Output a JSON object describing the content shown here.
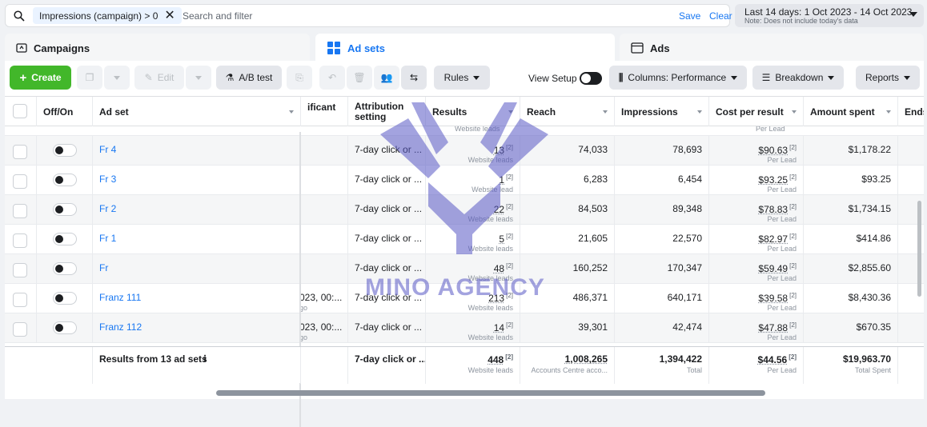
{
  "search": {
    "filter_chip": "Impressions (campaign) > 0",
    "placeholder": "Search and filter",
    "save_label": "Save",
    "clear_label": "Clear"
  },
  "date_range": {
    "label": "Last 14 days: 1 Oct 2023 - 14 Oct 2023",
    "note": "Note: Does not include today's data"
  },
  "tabs": [
    {
      "label": "Campaigns",
      "icon": "folder-icon"
    },
    {
      "label": "Ad sets",
      "icon": "grid-icon",
      "active": true
    },
    {
      "label": "Ads",
      "icon": "ad-icon"
    }
  ],
  "toolbar": {
    "create_label": "Create",
    "edit_label": "Edit",
    "abtest_label": "A/B test",
    "rules_label": "Rules",
    "view_setup_label": "View Setup",
    "columns_label": "Columns: Performance",
    "breakdown_label": "Breakdown",
    "reports_label": "Reports"
  },
  "columns": {
    "offon": "Off/On",
    "adset": "Ad set",
    "significant": "ificant",
    "attribution": "Attribution setting",
    "results": "Results",
    "reach": "Reach",
    "impressions": "Impressions",
    "cost": "Cost per result",
    "amount": "Amount spent",
    "ends": "Ends"
  },
  "top_partial": {
    "results_sub": "Website leads",
    "cost_sub": "Per Lead"
  },
  "rows": [
    {
      "name": "Fr 4",
      "sig": "",
      "sig_sub": "",
      "attr": "7-day click or ...",
      "results": "13",
      "results_sub": "Website leads",
      "reach": "74,033",
      "impressions": "78,693",
      "cost": "$90.63",
      "cost_sub": "Per Lead",
      "amount": "$1,178.22"
    },
    {
      "name": "Fr 3",
      "sig": "",
      "sig_sub": "",
      "attr": "7-day click or ...",
      "results": "1",
      "results_sub": "Website lead",
      "reach": "6,283",
      "impressions": "6,454",
      "cost": "$93.25",
      "cost_sub": "Per Lead",
      "amount": "$93.25"
    },
    {
      "name": "Fr 2",
      "sig": "",
      "sig_sub": "",
      "attr": "7-day click or ...",
      "results": "22",
      "results_sub": "Website leads",
      "reach": "84,503",
      "impressions": "89,348",
      "cost": "$78.83",
      "cost_sub": "Per Lead",
      "amount": "$1,734.15"
    },
    {
      "name": "Fr 1",
      "sig": "",
      "sig_sub": "",
      "attr": "7-day click or ...",
      "results": "5",
      "results_sub": "Website leads",
      "reach": "21,605",
      "impressions": "22,570",
      "cost": "$82.97",
      "cost_sub": "Per Lead",
      "amount": "$414.86"
    },
    {
      "name": "Fr",
      "sig": "",
      "sig_sub": "",
      "attr": "7-day click or ...",
      "results": "48",
      "results_sub": "Website leads",
      "reach": "160,252",
      "impressions": "170,347",
      "cost": "$59.49",
      "cost_sub": "Per Lead",
      "amount": "$2,855.60"
    },
    {
      "name": "Franz 111",
      "sig": "023, 00:...",
      "sig_sub": "go",
      "attr": "7-day click or ...",
      "results": "213",
      "results_sub": "Website leads",
      "reach": "486,371",
      "impressions": "640,171",
      "cost": "$39.58",
      "cost_sub": "Per Lead",
      "amount": "$8,430.36"
    },
    {
      "name": "Franz 112",
      "sig": "023, 00:...",
      "sig_sub": "go",
      "attr": "7-day click or ...",
      "results": "14",
      "results_sub": "Website leads",
      "reach": "39,301",
      "impressions": "42,474",
      "cost": "$47.88",
      "cost_sub": "Per Lead",
      "amount": "$670.35"
    }
  ],
  "footnote": "[2]",
  "totals": {
    "label": "Results from 13 ad sets",
    "attr": "7-day click or ...",
    "results": "448",
    "results_sub": "Website leads",
    "reach": "1,008,265",
    "reach_sub": "Accounts Centre acco...",
    "impressions": "1,394,422",
    "impressions_sub": "Total",
    "cost": "$44.56",
    "cost_sub": "Per Lead",
    "amount": "$19,963.70",
    "amount_sub": "Total Spent"
  },
  "watermark": {
    "text": "MINO AGENCY",
    "color": "#5858c4"
  },
  "colors": {
    "accent": "#1877f2",
    "create_green": "#42b72a"
  }
}
